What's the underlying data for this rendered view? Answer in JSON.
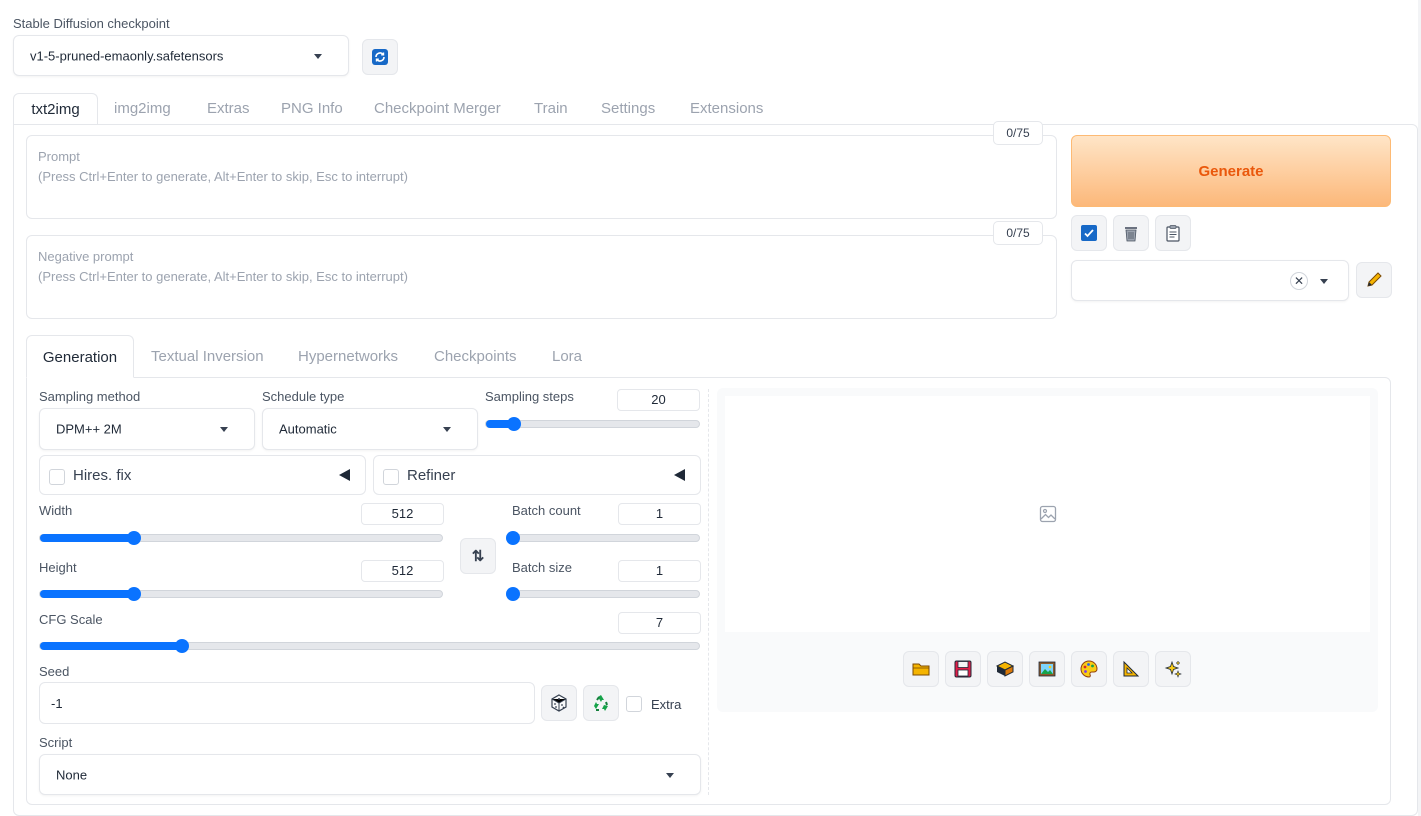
{
  "checkpoint": {
    "label": "Stable Diffusion checkpoint",
    "value": "v1-5-pruned-emaonly.safetensors"
  },
  "main_tabs": [
    "txt2img",
    "img2img",
    "Extras",
    "PNG Info",
    "Checkpoint Merger",
    "Train",
    "Settings",
    "Extensions"
  ],
  "prompt": {
    "placeholder_title": "Prompt",
    "placeholder_hint": "(Press Ctrl+Enter to generate, Alt+Enter to skip, Esc to interrupt)",
    "token_count": "0/75"
  },
  "negative_prompt": {
    "placeholder_title": "Negative prompt",
    "placeholder_hint": "(Press Ctrl+Enter to generate, Alt+Enter to skip, Esc to interrupt)",
    "token_count": "0/75"
  },
  "generate_label": "Generate",
  "sub_tabs": [
    "Generation",
    "Textual Inversion",
    "Hypernetworks",
    "Checkpoints",
    "Lora"
  ],
  "sampling": {
    "method_label": "Sampling method",
    "method_value": "DPM++ 2M",
    "schedule_label": "Schedule type",
    "schedule_value": "Automatic",
    "steps_label": "Sampling steps",
    "steps_value": "20",
    "steps_fraction": 0.13
  },
  "hires_fix_label": "Hires. fix",
  "refiner_label": "Refiner",
  "width": {
    "label": "Width",
    "value": "512",
    "fraction": 0.235
  },
  "height": {
    "label": "Height",
    "value": "512",
    "fraction": 0.235
  },
  "batch_count": {
    "label": "Batch count",
    "value": "1",
    "fraction": 0.0
  },
  "batch_size": {
    "label": "Batch size",
    "value": "1",
    "fraction": 0.0
  },
  "cfg_scale": {
    "label": "CFG Scale",
    "value": "7",
    "fraction": 0.215
  },
  "seed": {
    "label": "Seed",
    "value": "-1",
    "extra_label": "Extra"
  },
  "script": {
    "label": "Script",
    "value": "None"
  },
  "colors": {
    "accent": "#0a73ff",
    "generate_text": "#ea580c",
    "generate_bg_top": "#ffe5c7",
    "generate_bg_bottom": "#fcb87a"
  }
}
